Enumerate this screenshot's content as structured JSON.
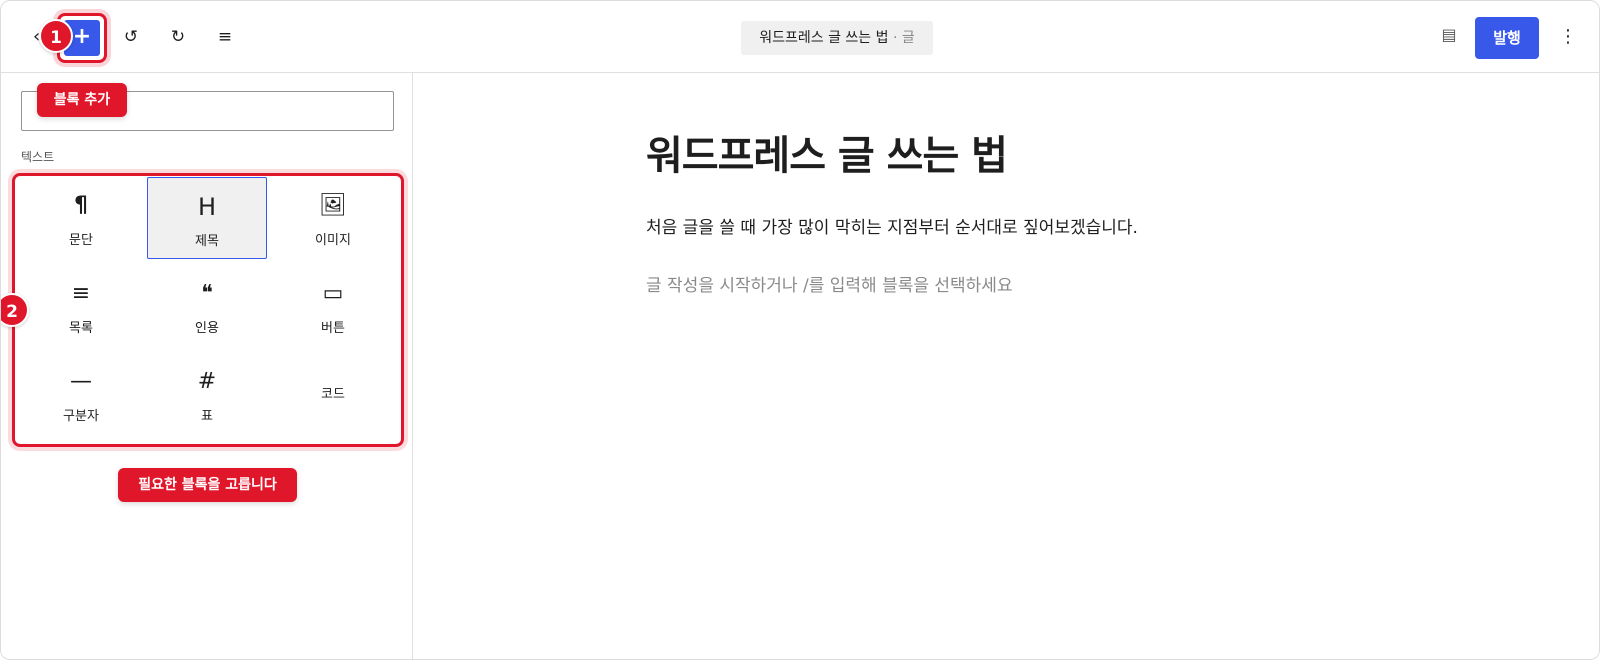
{
  "toolbar": {
    "back_icon": "chevron-left-icon",
    "add_label": "+",
    "undo_glyph": "↺",
    "redo_glyph": "↻",
    "outline_glyph": "≡",
    "doc_title": "워드프레스 글 쓰는 법",
    "doc_separator": " · ",
    "doc_type": "글",
    "settings_glyph": "▤",
    "publish_label": "발행",
    "more_glyph": "⋮"
  },
  "callouts": {
    "one": {
      "number": "1",
      "label": "블록 추가"
    },
    "two": {
      "number": "2",
      "label": "필요한 블록을 고릅니다"
    }
  },
  "inserter": {
    "search_value": "",
    "category": "텍스트",
    "blocks": [
      {
        "label": "문단",
        "glyph": "¶",
        "icon": "paragraph-icon"
      },
      {
        "label": "제목",
        "glyph": "H",
        "icon": "heading-icon",
        "selected": true
      },
      {
        "label": "이미지",
        "glyph": "🖼",
        "icon": "image-icon"
      },
      {
        "label": "목록",
        "glyph": "≡",
        "icon": "list-icon"
      },
      {
        "label": "인용",
        "glyph": "❝",
        "icon": "quote-icon"
      },
      {
        "label": "버튼",
        "glyph": "▭",
        "icon": "button-icon"
      },
      {
        "label": "구분자",
        "glyph": "—",
        "icon": "separator-icon"
      },
      {
        "label": "표",
        "glyph": "#",
        "icon": "table-icon"
      },
      {
        "label": "코드",
        "glyph": "",
        "icon": "code-icon"
      }
    ]
  },
  "editor": {
    "title": "워드프레스 글 쓰는 법",
    "paragraph": "처음 글을 쓸 때 가장 많이 막히는 지점부터 순서대로 짚어보겠습니다.",
    "placeholder": "글 작성을 시작하거나 /를 입력해 블록을 선택하세요"
  },
  "colors": {
    "accent": "#3858e9",
    "callout": "#e0162b"
  }
}
